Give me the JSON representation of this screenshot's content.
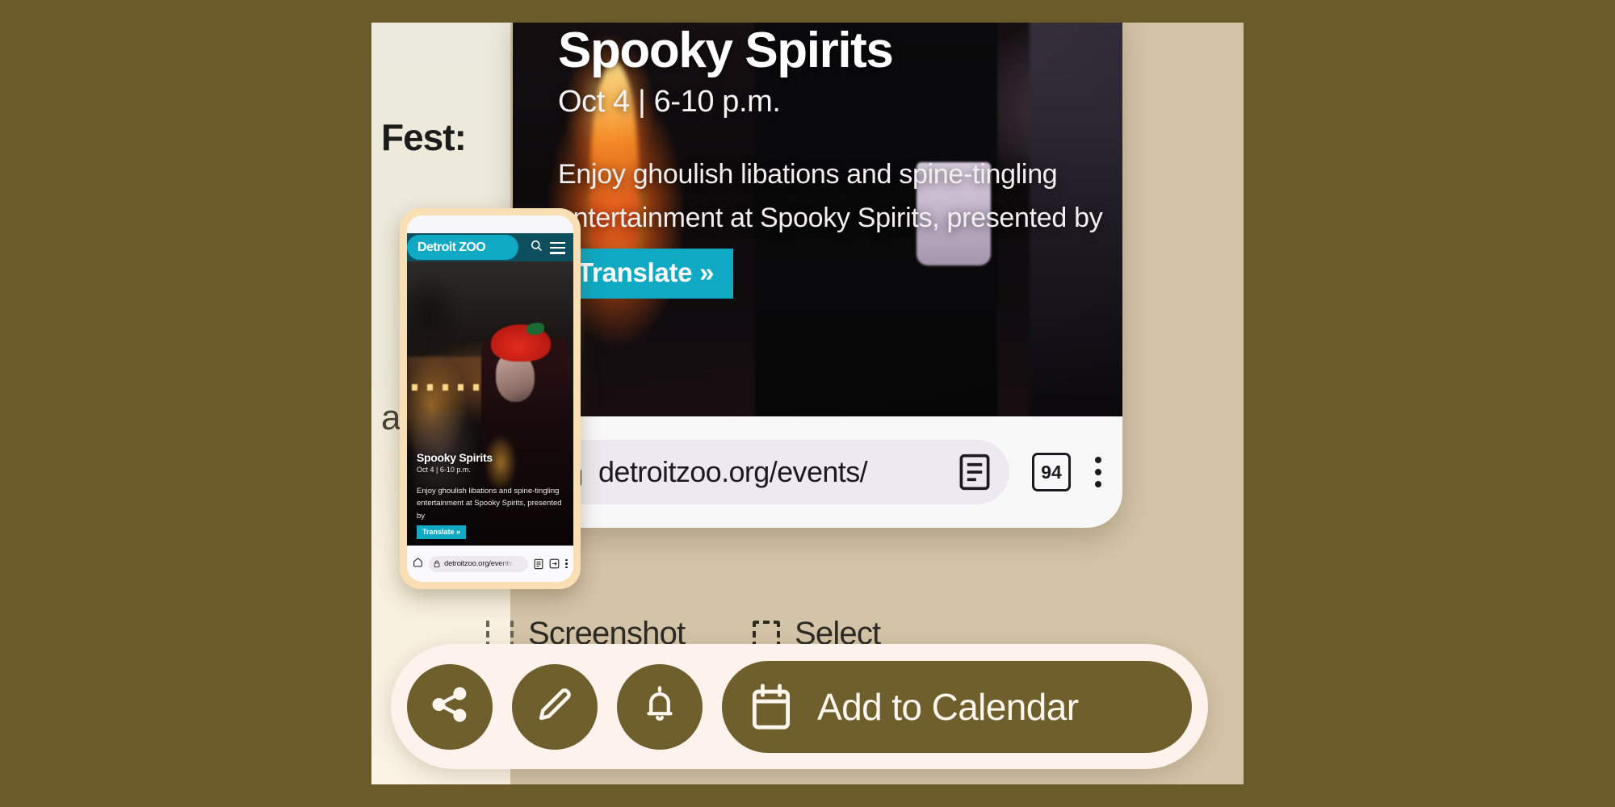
{
  "theme": {
    "outer_bg": "#6b5a2a",
    "stage_bg": "#d3c3a7",
    "accent_teal": "#0fa9c4",
    "header_teal_dark": "#0d4f5e",
    "olive": "#6f5f2d",
    "action_bar_bg": "#fdf2ec",
    "phone_glow": "#fbdfb4"
  },
  "background_page": {
    "fest_text": "Fest:",
    "an_text": "an-"
  },
  "browser": {
    "hero": {
      "title": "Spooky Spirits",
      "date": "Oct 4 | 6-10 p.m.",
      "body": "Enjoy ghoulish libations and spine-tingling entertainment at Spooky Spirits, presented by",
      "translate_label": "Translate »"
    },
    "omnibox": {
      "url": "detroitzoo.org/events/",
      "lock_icon": "lock-icon",
      "reader_icon": "reader-mode-icon",
      "tab_count": "94",
      "menu_icon": "kebab-menu-icon"
    }
  },
  "phone_preview": {
    "site_header": {
      "logo_text": "Detroit ZOO",
      "search_icon": "search-icon",
      "menu_icon": "hamburger-menu-icon"
    },
    "hero": {
      "title": "Spooky Spirits",
      "date": "Oct 4 | 6-10 p.m.",
      "body": "Enjoy ghoulish libations and spine-tingling entertainment at Spooky Spirits, presented by",
      "translate_label": "Translate »"
    },
    "omnibox": {
      "home_icon": "home-icon",
      "lock_icon": "lock-icon",
      "url": "detroitzoo.org/events",
      "reader_icon": "reader-mode-icon",
      "tab_icon": "tab-switcher-icon",
      "menu_icon": "kebab-menu-icon"
    }
  },
  "background_labels": {
    "screenshot": "Screenshot",
    "select": "Select"
  },
  "action_bar": {
    "share_icon": "share-icon",
    "edit_icon": "pencil-edit-icon",
    "notify_icon": "bell-notification-icon",
    "calendar_icon": "calendar-icon",
    "calendar_label": "Add to Calendar"
  }
}
